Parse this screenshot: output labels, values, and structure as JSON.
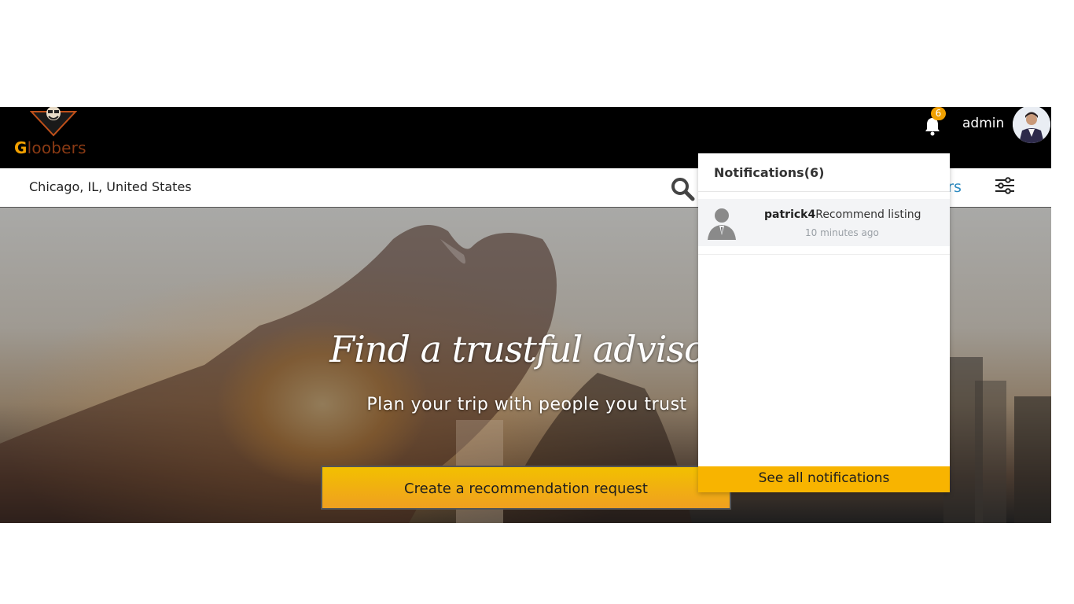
{
  "header": {
    "logo_text_first": "G",
    "logo_text_rest": "loobers",
    "notification_count": "6",
    "username": "admin"
  },
  "search": {
    "location": "Chicago, IL, United States",
    "filters_label": "Filters"
  },
  "hero": {
    "title": "Find a trustful advisor",
    "subtitle": "Plan your trip with people you trust",
    "cta_label": "Create a recommendation request"
  },
  "notifications": {
    "title": "Notifications(6)",
    "items": [
      {
        "user": "patrick4",
        "message": "Recommend listing",
        "time": "10 minutes ago"
      }
    ],
    "see_all_label": "See all notifications"
  },
  "colors": {
    "topbar": "#000000",
    "accent": "#f8b400",
    "badge": "#f0a000",
    "filters_link": "#2e8bc0"
  }
}
